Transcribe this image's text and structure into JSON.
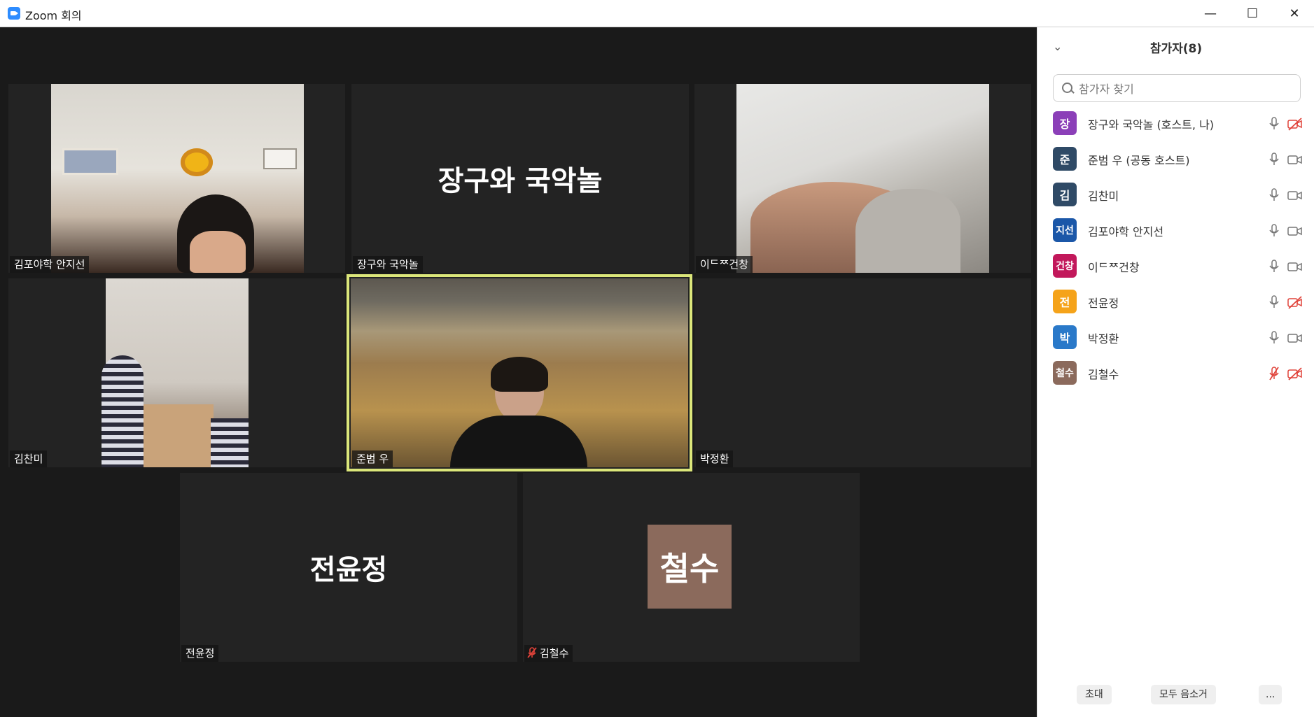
{
  "window": {
    "title": "Zoom 회의",
    "min_symbol": "—",
    "max_symbol": "☐",
    "close_symbol": "✕"
  },
  "tiles": {
    "t1": {
      "name": "김포야학 안지선"
    },
    "t2": {
      "name": "장구와 국악놀",
      "display": "장구와 국악놀"
    },
    "t3": {
      "name": "이ᄃᄍ건창"
    },
    "t4": {
      "name": "김찬미"
    },
    "t5": {
      "name": "준범 우"
    },
    "t6": {
      "name": "박정환"
    },
    "t7": {
      "name": "전윤정",
      "display": "전윤정"
    },
    "t8": {
      "name": "김철수",
      "avatar": "철수"
    }
  },
  "panel": {
    "title": "참가자(8)",
    "search_placeholder": "참가자 찾기",
    "participants": [
      {
        "avatar": "장",
        "name": "장구와 국악놀 (호스트, 나)",
        "color": "#8b3fb8",
        "mic_muted": false,
        "video_off": true
      },
      {
        "avatar": "준",
        "name": "준범 우 (공동 호스트)",
        "color": "#2f4a66",
        "mic_muted": false,
        "video_off": false
      },
      {
        "avatar": "김",
        "name": "김찬미",
        "color": "#2f4a66",
        "mic_muted": false,
        "video_off": false
      },
      {
        "avatar": "지선",
        "name": "김포야학 안지선",
        "color": "#1b57a8",
        "mic_muted": false,
        "video_off": false
      },
      {
        "avatar": "건창",
        "name": "이ᄃᄍ건창",
        "color": "#c2185b",
        "mic_muted": false,
        "video_off": false
      },
      {
        "avatar": "전",
        "name": "전윤정",
        "color": "#f5a31a",
        "mic_muted": false,
        "video_off": true
      },
      {
        "avatar": "박",
        "name": "박정환",
        "color": "#2a79c9",
        "mic_muted": false,
        "video_off": false
      },
      {
        "avatar": "철수",
        "name": "김철수",
        "color": "#8b6a5c",
        "mic_muted": true,
        "video_off": true
      }
    ],
    "footer": {
      "invite": "초대",
      "mute_all": "모두 음소거",
      "more": "..."
    }
  }
}
